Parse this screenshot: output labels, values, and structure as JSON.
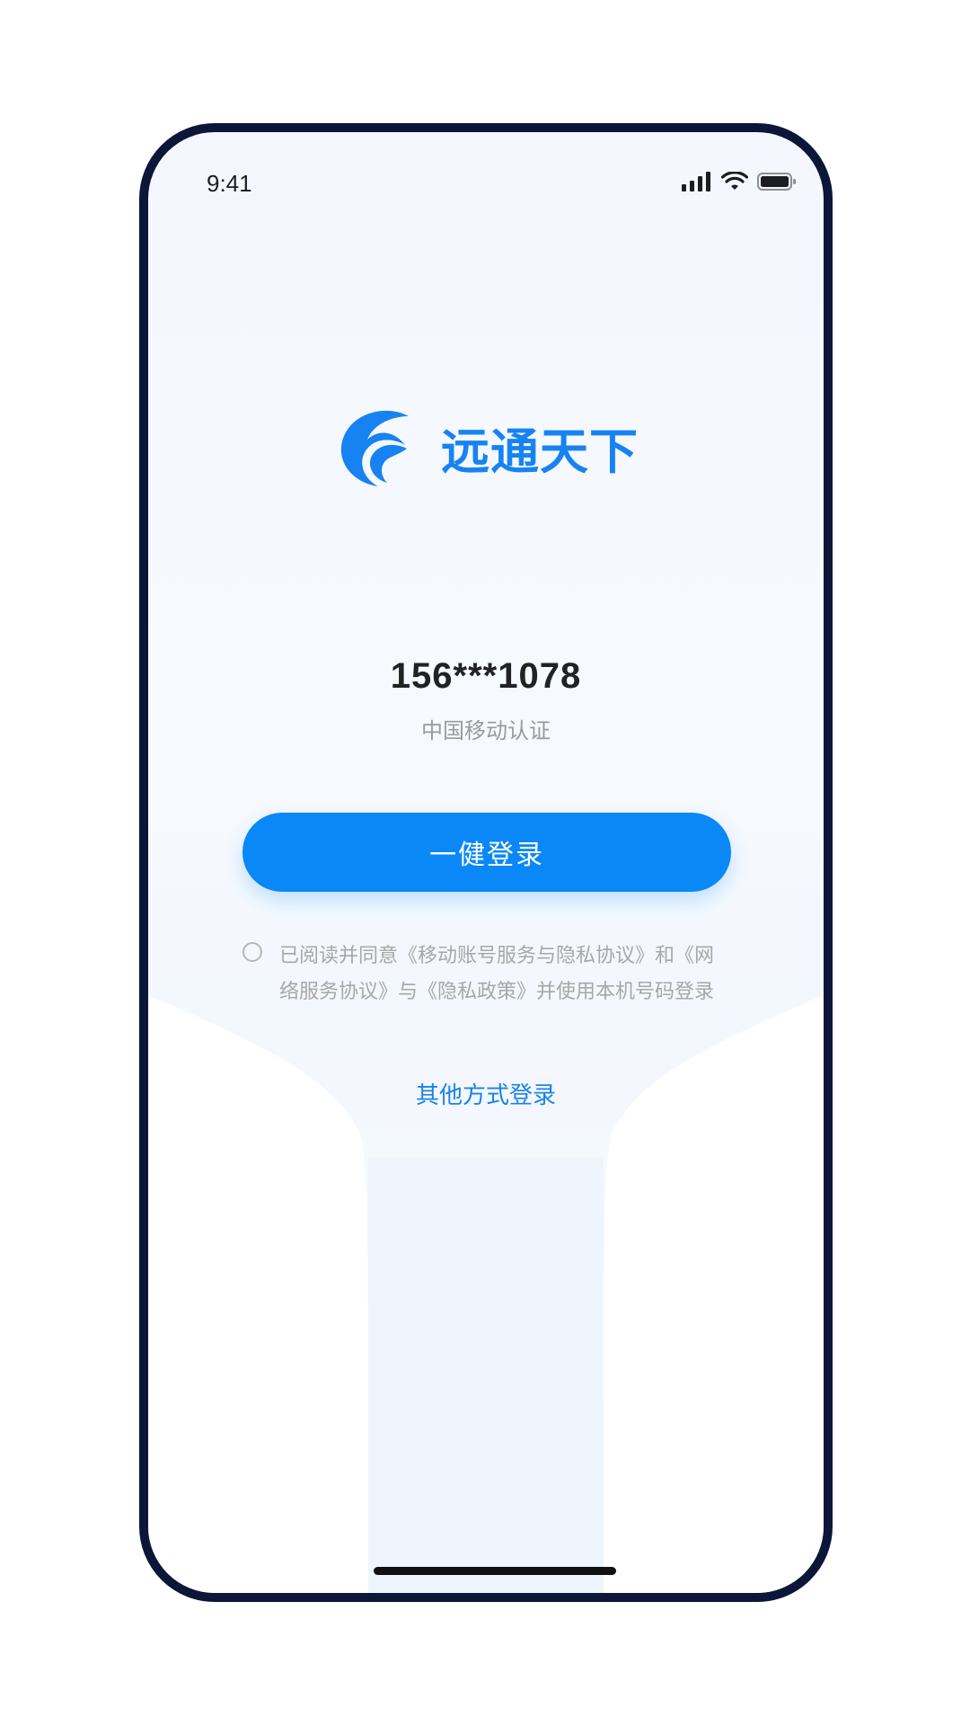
{
  "status_bar": {
    "time": "9:41"
  },
  "brand": {
    "name": "远通天下",
    "color": "#1783f2"
  },
  "account": {
    "masked_phone": "156***1078",
    "carrier_auth": "中国移动认证"
  },
  "actions": {
    "one_click_login": "一健登录",
    "other_login": "其他方式登录"
  },
  "agreement": {
    "checked": false,
    "text": "已阅读并同意《移动账号服务与隐私协议》和《网络服务协议》与《隐私政策》并使用本机号码登录"
  },
  "colors": {
    "primary_button": "#0a88f7",
    "link": "#1a83e8",
    "frame": "#0b1638"
  },
  "icons": {
    "signal": "signal-icon",
    "wifi": "wifi-icon",
    "battery": "battery-icon"
  }
}
